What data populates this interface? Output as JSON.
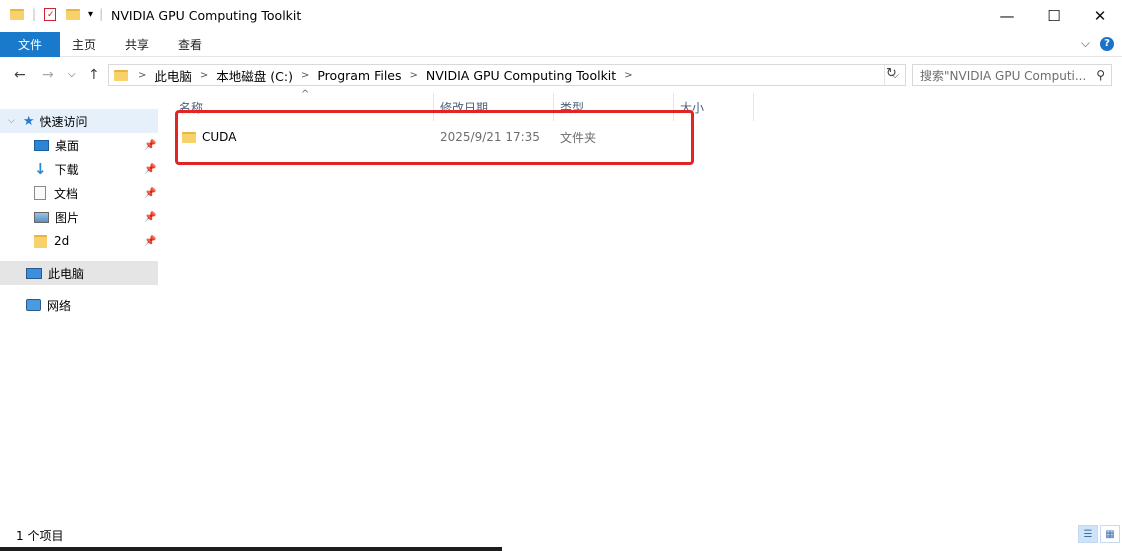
{
  "window": {
    "title": "NVIDIA GPU Computing Toolkit",
    "minimize": "—",
    "maximize": "☐",
    "close": "✕"
  },
  "ribbon": {
    "file": "文件",
    "home": "主页",
    "share": "共享",
    "view": "查看",
    "collapse": "⌵",
    "help": "?"
  },
  "address": {
    "back": "←",
    "forward": "→",
    "recent": "⌵",
    "up": "↑",
    "crumbs": [
      "此电脑",
      "本地磁盘 (C:)",
      "Program Files",
      "NVIDIA GPU Computing Toolkit"
    ],
    "sep": ">",
    "dropdown": "⌵",
    "refresh": "↻"
  },
  "search": {
    "placeholder": "搜索\"NVIDIA GPU Computi...",
    "icon": "search-icon"
  },
  "nav": {
    "quick_access": "快速访问",
    "items": [
      {
        "label": "桌面",
        "icon": "desktop-icon"
      },
      {
        "label": "下载",
        "icon": "download-icon"
      },
      {
        "label": "文档",
        "icon": "document-icon"
      },
      {
        "label": "图片",
        "icon": "picture-icon"
      },
      {
        "label": "2d",
        "icon": "folder-icon"
      }
    ],
    "this_pc": "此电脑",
    "network": "网络"
  },
  "columns": {
    "name": "名称",
    "modified": "修改日期",
    "type": "类型",
    "size": "大小",
    "sort_arrow": "^"
  },
  "files": [
    {
      "name": "CUDA",
      "modified": "2025/9/21 17:35",
      "type": "文件夹",
      "size": ""
    }
  ],
  "status": {
    "count": "1 个项目"
  },
  "colors": {
    "accent": "#1979ca",
    "highlight_border": "#e12424",
    "selected_nav": "#e5e5e5"
  }
}
